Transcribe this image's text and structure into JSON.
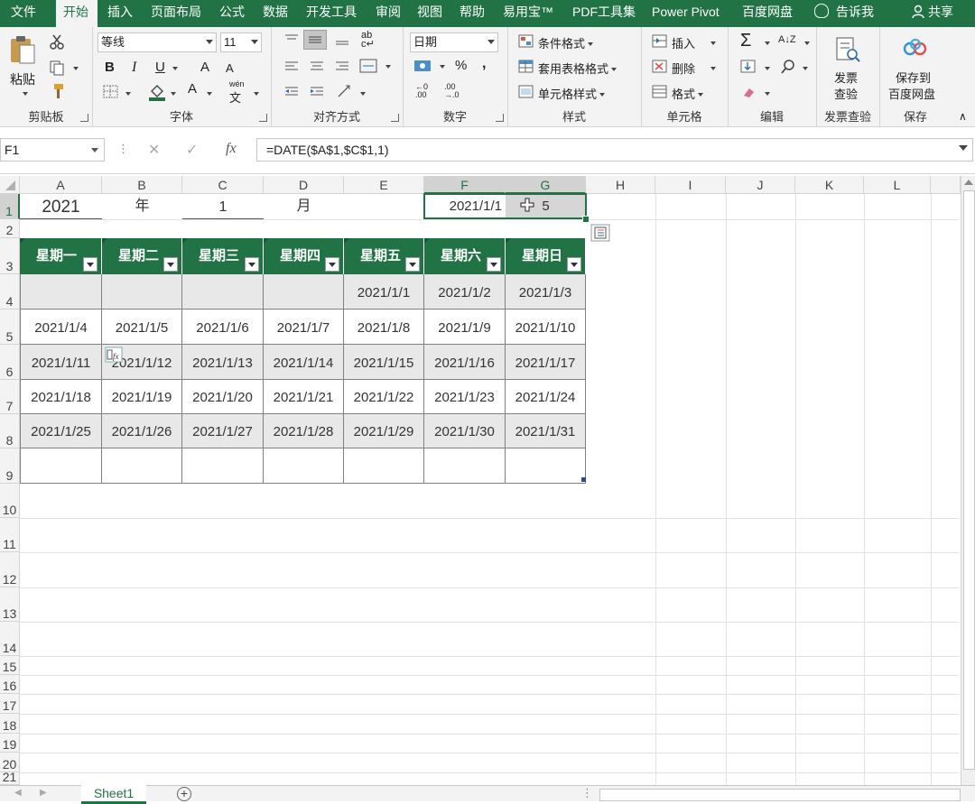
{
  "tabs": [
    "文件",
    "开始",
    "插入",
    "页面布局",
    "公式",
    "数据",
    "开发工具",
    "审阅",
    "视图",
    "帮助",
    "易用宝™",
    "PDF工具集",
    "Power Pivot",
    "百度网盘",
    "告诉我",
    "共享"
  ],
  "ribbon": {
    "clipboard": {
      "paste": "粘贴",
      "label": "剪贴板"
    },
    "font": {
      "name": "等线",
      "size": "11",
      "bold": "B",
      "italic": "I",
      "underline": "U",
      "grow": "A",
      "shrink": "A",
      "color_a": "A",
      "wen": "wén",
      "wen2": "文",
      "label": "字体"
    },
    "align": {
      "label": "对齐方式",
      "wrap": "ab"
    },
    "number": {
      "format": "日期",
      "percent": "%",
      "comma": ",",
      "label": "数字"
    },
    "styles": {
      "cond": "条件格式",
      "table": "套用表格格式",
      "cell": "单元格样式",
      "label": "样式"
    },
    "cells": {
      "insert": "插入",
      "delete": "删除",
      "format": "格式",
      "label": "单元格"
    },
    "editing": {
      "label": "编辑"
    },
    "invoice": {
      "line1": "发票",
      "line2": "查验",
      "label": "发票查验"
    },
    "save": {
      "line1": "保存到",
      "line2": "百度网盘",
      "label": "保存"
    }
  },
  "formula_bar": {
    "name_box": "F1",
    "cancel": "✕",
    "enter": "✓",
    "fx": "fx",
    "formula": "=DATE($A$1,$C$1,1)"
  },
  "columns": [
    "A",
    "B",
    "C",
    "D",
    "E",
    "F",
    "G",
    "H",
    "I",
    "J",
    "K",
    "L"
  ],
  "rows": [
    "1",
    "2",
    "3",
    "4",
    "5",
    "6",
    "7",
    "8",
    "9",
    "10",
    "11",
    "12",
    "13",
    "14",
    "15",
    "16",
    "17",
    "18",
    "19",
    "20",
    "21"
  ],
  "row1": {
    "year": "2021",
    "year_label": "年",
    "month": "1",
    "month_label": "月",
    "f1": "2021/1/1",
    "g1": "5"
  },
  "calendar": {
    "headers": [
      "星期一",
      "星期二",
      "星期三",
      "星期四",
      "星期五",
      "星期六",
      "星期日"
    ],
    "weeks": [
      [
        "",
        "",
        "",
        "",
        "2021/1/1",
        "2021/1/2",
        "2021/1/3"
      ],
      [
        "2021/1/4",
        "2021/1/5",
        "2021/1/6",
        "2021/1/7",
        "2021/1/8",
        "2021/1/9",
        "2021/1/10"
      ],
      [
        "2021/1/11",
        "2021/1/12",
        "2021/1/13",
        "2021/1/14",
        "2021/1/15",
        "2021/1/16",
        "2021/1/17"
      ],
      [
        "2021/1/18",
        "2021/1/19",
        "2021/1/20",
        "2021/1/21",
        "2021/1/22",
        "2021/1/23",
        "2021/1/24"
      ],
      [
        "2021/1/25",
        "2021/1/26",
        "2021/1/27",
        "2021/1/28",
        "2021/1/29",
        "2021/1/30",
        "2021/1/31"
      ],
      [
        "",
        "",
        "",
        "",
        "",
        "",
        ""
      ]
    ]
  },
  "sheet": {
    "name": "Sheet1"
  },
  "colors": {
    "accent": "#217346",
    "band": "#e8e8e8"
  }
}
